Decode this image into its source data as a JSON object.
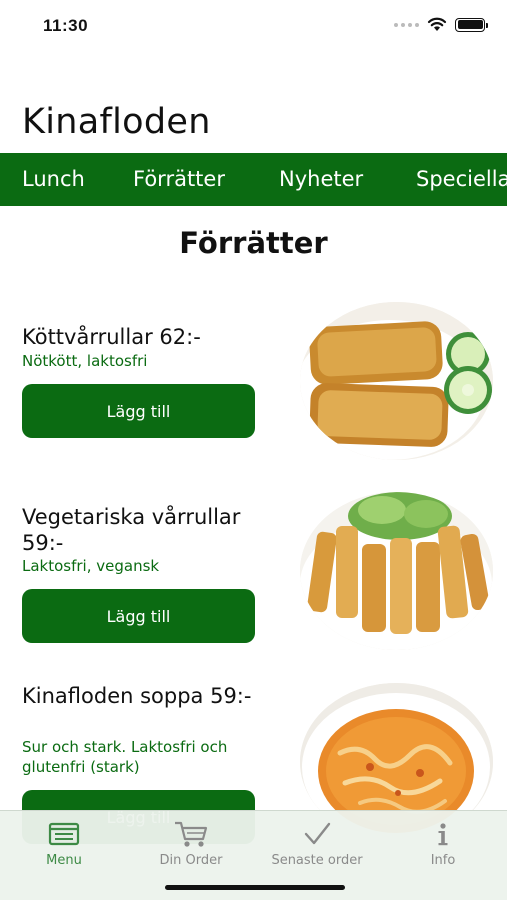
{
  "status_bar": {
    "time": "11:30"
  },
  "app": {
    "title": "Kinafloden"
  },
  "categories": {
    "tabs": [
      {
        "label": "Lunch"
      },
      {
        "label": "Förrätter"
      },
      {
        "label": "Nyheter"
      },
      {
        "label": "Speciella"
      }
    ],
    "selected": "Förrätter"
  },
  "section": {
    "title": "Förrätter"
  },
  "menu_items": [
    {
      "name": "Köttvårrullar 62:-",
      "description": "Nötkött, laktosfri",
      "button_label": "Lägg till"
    },
    {
      "name": "Vegetariska vårrullar 59:-",
      "description": "Laktosfri, vegansk",
      "button_label": "Lägg till"
    },
    {
      "name": "Kinafloden soppa 59:-",
      "description": "Sur och stark. Laktosfri och glutenfri (stark)",
      "button_label": "Lägg till"
    }
  ],
  "tab_bar": {
    "items": [
      {
        "label": "Menu",
        "icon": "menu-list-icon",
        "active": true
      },
      {
        "label": "Din Order",
        "icon": "cart-icon",
        "active": false
      },
      {
        "label": "Senaste order",
        "icon": "checkmark-icon",
        "active": false
      },
      {
        "label": "Info",
        "icon": "info-icon",
        "active": false
      }
    ]
  },
  "colors": {
    "brand_green": "#0b6b12",
    "tab_active": "#3d8a45",
    "tab_inactive": "#8a8a8a"
  }
}
